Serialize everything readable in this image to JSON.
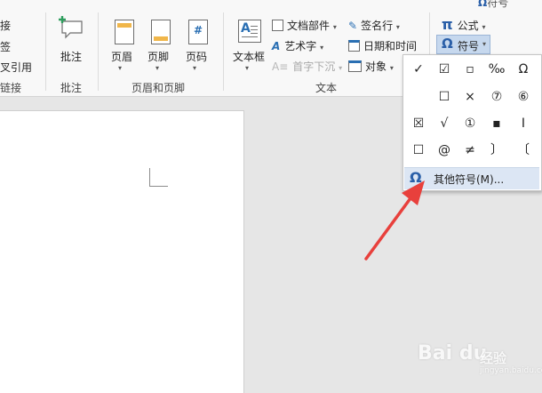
{
  "left_group": {
    "items": [
      "接",
      "签",
      "叉引用",
      "链接"
    ],
    "caption": "链接"
  },
  "comment_group": {
    "button": "批注",
    "caption": "批注"
  },
  "header_footer_group": {
    "header": "页眉",
    "footer": "页脚",
    "page_number": "页码",
    "caption": "页眉和页脚"
  },
  "text_group": {
    "textbox": "文本框",
    "quick_parts": "文档部件",
    "wordart": "艺术字",
    "dropcap": "首字下沉",
    "signature_line": "签名行",
    "date_time": "日期和时间",
    "object": "对象",
    "caption": "文本"
  },
  "symbols_group": {
    "equation_icon": "π",
    "equation": "公式",
    "symbol_icon": "Ω",
    "symbol": "符号"
  },
  "top_right_partial": "符号",
  "symbol_dropdown": {
    "symbols": [
      "✓",
      "☑",
      "▫",
      "‰",
      "Ω",
      "☐",
      "×",
      "⑦",
      "⑥",
      "☒",
      "√",
      "①",
      "▪",
      "Ⅰ",
      "☐",
      "@",
      "≠",
      "〕",
      "〔"
    ],
    "more_symbols_icon": "Ω",
    "more_symbols_label": "其他符号(M)..."
  },
  "watermark": {
    "brand": "Bai du",
    "product": "经验",
    "url": "jingyan.baidu.com"
  },
  "colors": {
    "accent": "#2a6fb3",
    "selected_button": "#c6d8ee",
    "arrow": "#e8403c"
  }
}
